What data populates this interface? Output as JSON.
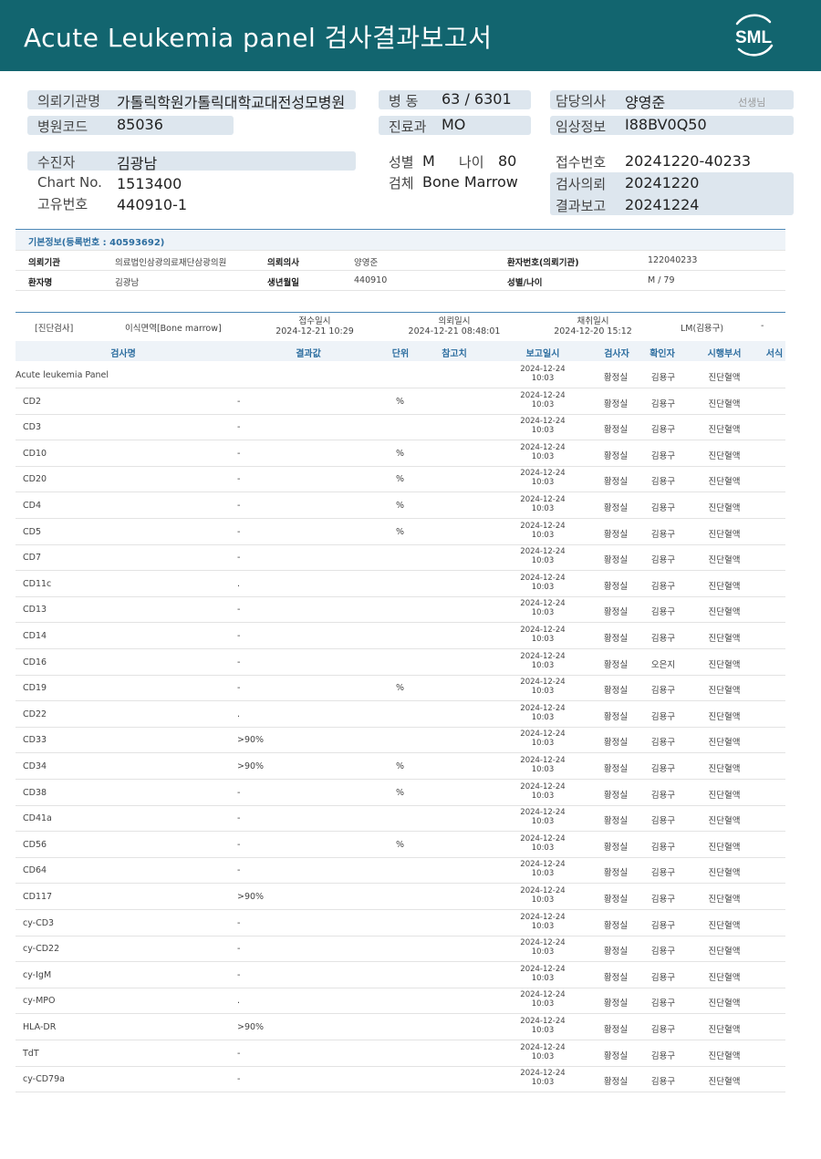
{
  "header": {
    "title": "Acute  Leukemia  panel 검사결과보고서",
    "logo_text": "SML"
  },
  "info": {
    "institution_label": "의뢰기관명",
    "institution": "가톨릭학원가톨릭대학교대전성모병원",
    "hospital_code_label": "병원코드",
    "hospital_code": "85036",
    "ward_label": "병  동",
    "ward": "63 / 6301",
    "dept_label": "진료과",
    "dept": "MO",
    "doctor_label": "담당의사",
    "doctor": "양영준",
    "doctor_suffix": "선생님",
    "clinical_label": "임상정보",
    "clinical": "I88BV0Q50",
    "patient_label": "수진자",
    "patient": "김광남",
    "chart_label": "Chart No.",
    "chart": "1513400",
    "unique_label": "고유번호",
    "unique": "440910-1",
    "sex_label": "성별",
    "sex": "M",
    "age_label": "나이",
    "age": "80",
    "specimen_label": "검체",
    "specimen": "Bone Marrow",
    "receipt_label": "접수번호",
    "receipt": "20241220-40233",
    "request_label": "검사의뢰",
    "request": "20241220",
    "report_label": "결과보고",
    "report": "20241224"
  },
  "basic": {
    "heading": "기본정보(등록번호 : 40593692)",
    "inst_label": "의뢰기관",
    "inst": "의료법인삼광의료재단삼광의원",
    "doc_label": "의뢰의사",
    "doc": "양영준",
    "pt_no_label": "환자번호(의뢰기관)",
    "pt_no": "122040233",
    "name_label": "환자명",
    "name": "김광남",
    "dob_label": "생년월일",
    "dob": "440910",
    "sexage_label": "성별/나이",
    "sexage": "M / 79"
  },
  "diagnosis": {
    "category": "[진단검사]",
    "test": "이식면역[Bone marrow]",
    "receipt_label": "접수일시",
    "receipt_dt": "2024-12-21 10:29",
    "request_label": "의뢰일시",
    "request_dt": "2024-12-21 08:48:01",
    "collect_label": "채취일시",
    "collect_dt": "2024-12-20 15:12",
    "reviewer": "LM(김용구)",
    "dash": "-"
  },
  "columns": {
    "test": "검사명",
    "result": "결과값",
    "unit": "단위",
    "ref": "참고치",
    "report_dt": "보고일시",
    "tester": "검사자",
    "checker": "확인자",
    "dept": "시행부서",
    "format": "서식"
  },
  "rows": [
    {
      "name": "Acute leukemia Panel",
      "result": "",
      "unit": "",
      "date1": "2024-12-24",
      "date2": "10:03",
      "tester": "황정실",
      "checker": "김용구",
      "dept": "진단혈액"
    },
    {
      "name": "CD2",
      "result": "-",
      "unit": "%",
      "date1": "2024-12-24",
      "date2": "10:03",
      "tester": "황정실",
      "checker": "김용구",
      "dept": "진단혈액"
    },
    {
      "name": "CD3",
      "result": "-",
      "unit": "",
      "date1": "2024-12-24",
      "date2": "10:03",
      "tester": "황정실",
      "checker": "김용구",
      "dept": "진단혈액"
    },
    {
      "name": "CD10",
      "result": "-",
      "unit": "%",
      "date1": "2024-12-24",
      "date2": "10:03",
      "tester": "황정실",
      "checker": "김용구",
      "dept": "진단혈액"
    },
    {
      "name": "CD20",
      "result": "-",
      "unit": "%",
      "date1": "2024-12-24",
      "date2": "10:03",
      "tester": "황정실",
      "checker": "김용구",
      "dept": "진단혈액"
    },
    {
      "name": "CD4",
      "result": "-",
      "unit": "%",
      "date1": "2024-12-24",
      "date2": "10:03",
      "tester": "황정실",
      "checker": "김용구",
      "dept": "진단혈액"
    },
    {
      "name": "CD5",
      "result": "-",
      "unit": "%",
      "date1": "2024-12-24",
      "date2": "10:03",
      "tester": "황정실",
      "checker": "김용구",
      "dept": "진단혈액"
    },
    {
      "name": "CD7",
      "result": "-",
      "unit": "",
      "date1": "2024-12-24",
      "date2": "10:03",
      "tester": "황정실",
      "checker": "김용구",
      "dept": "진단혈액"
    },
    {
      "name": "CD11c",
      "result": ".",
      "unit": "",
      "date1": "2024-12-24",
      "date2": "10:03",
      "tester": "황정실",
      "checker": "김용구",
      "dept": "진단혈액"
    },
    {
      "name": "CD13",
      "result": "-",
      "unit": "",
      "date1": "2024-12-24",
      "date2": "10:03",
      "tester": "황정실",
      "checker": "김용구",
      "dept": "진단혈액"
    },
    {
      "name": "CD14",
      "result": "-",
      "unit": "",
      "date1": "2024-12-24",
      "date2": "10:03",
      "tester": "황정실",
      "checker": "김용구",
      "dept": "진단혈액"
    },
    {
      "name": "CD16",
      "result": "-",
      "unit": "",
      "date1": "2024-12-24",
      "date2": "10:03",
      "tester": "황정실",
      "checker": "오은지",
      "dept": "진단혈액"
    },
    {
      "name": "CD19",
      "result": "-",
      "unit": "%",
      "date1": "2024-12-24",
      "date2": "10:03",
      "tester": "황정실",
      "checker": "김용구",
      "dept": "진단혈액"
    },
    {
      "name": "CD22",
      "result": ".",
      "unit": "",
      "date1": "2024-12-24",
      "date2": "10:03",
      "tester": "황정실",
      "checker": "김용구",
      "dept": "진단혈액"
    },
    {
      "name": "CD33",
      "result": ">90%",
      "unit": "",
      "date1": "2024-12-24",
      "date2": "10:03",
      "tester": "황정실",
      "checker": "김용구",
      "dept": "진단혈액"
    },
    {
      "name": "CD34",
      "result": ">90%",
      "unit": "%",
      "date1": "2024-12-24",
      "date2": "10:03",
      "tester": "황정실",
      "checker": "김용구",
      "dept": "진단혈액"
    },
    {
      "name": "CD38",
      "result": "-",
      "unit": "%",
      "date1": "2024-12-24",
      "date2": "10:03",
      "tester": "황정실",
      "checker": "김용구",
      "dept": "진단혈액"
    },
    {
      "name": "CD41a",
      "result": "-",
      "unit": "",
      "date1": "2024-12-24",
      "date2": "10:03",
      "tester": "황정실",
      "checker": "김용구",
      "dept": "진단혈액"
    },
    {
      "name": "CD56",
      "result": "-",
      "unit": "%",
      "date1": "2024-12-24",
      "date2": "10:03",
      "tester": "황정실",
      "checker": "김용구",
      "dept": "진단혈액"
    },
    {
      "name": "CD64",
      "result": "-",
      "unit": "",
      "date1": "2024-12-24",
      "date2": "10:03",
      "tester": "황정실",
      "checker": "김용구",
      "dept": "진단혈액"
    },
    {
      "name": "CD117",
      "result": ">90%",
      "unit": "",
      "date1": "2024-12-24",
      "date2": "10:03",
      "tester": "황정실",
      "checker": "김용구",
      "dept": "진단혈액"
    },
    {
      "name": "cy-CD3",
      "result": "-",
      "unit": "",
      "date1": "2024-12-24",
      "date2": "10:03",
      "tester": "황정실",
      "checker": "김용구",
      "dept": "진단혈액"
    },
    {
      "name": "cy-CD22",
      "result": "-",
      "unit": "",
      "date1": "2024-12-24",
      "date2": "10:03",
      "tester": "황정실",
      "checker": "김용구",
      "dept": "진단혈액"
    },
    {
      "name": "cy-IgM",
      "result": "-",
      "unit": "",
      "date1": "2024-12-24",
      "date2": "10:03",
      "tester": "황정실",
      "checker": "김용구",
      "dept": "진단혈액"
    },
    {
      "name": "cy-MPO",
      "result": ".",
      "unit": "",
      "date1": "2024-12-24",
      "date2": "10:03",
      "tester": "황정실",
      "checker": "김용구",
      "dept": "진단혈액"
    },
    {
      "name": "HLA-DR",
      "result": ">90%",
      "unit": "",
      "date1": "2024-12-24",
      "date2": "10:03",
      "tester": "황정실",
      "checker": "김용구",
      "dept": "진단혈액"
    },
    {
      "name": "TdT",
      "result": "-",
      "unit": "",
      "date1": "2024-12-24",
      "date2": "10:03",
      "tester": "황정실",
      "checker": "김용구",
      "dept": "진단혈액"
    },
    {
      "name": "cy-CD79a",
      "result": "-",
      "unit": "",
      "date1": "2024-12-24",
      "date2": "10:03",
      "tester": "황정실",
      "checker": "김용구",
      "dept": "진단혈액"
    }
  ]
}
